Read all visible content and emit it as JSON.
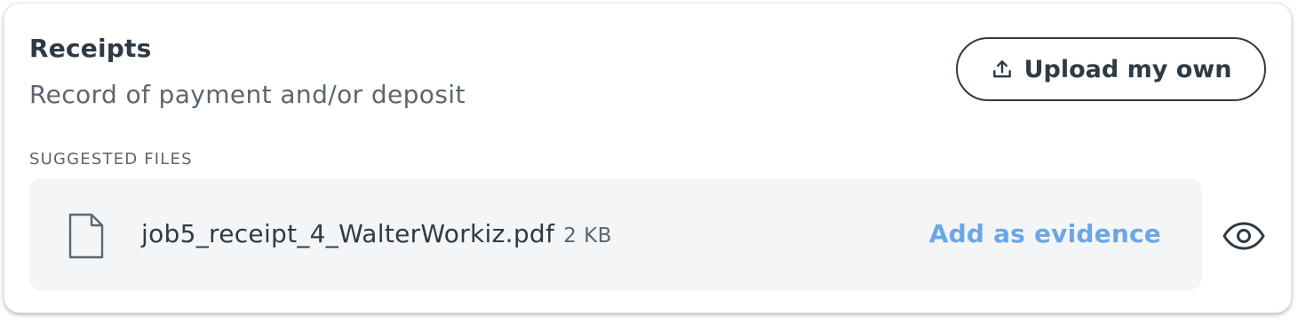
{
  "card": {
    "title": "Receipts",
    "subtitle": "Record of payment and/or deposit",
    "upload_button_label": "Upload my own"
  },
  "suggested": {
    "section_label": "SUGGESTED FILES",
    "files": [
      {
        "name": "job5_receipt_4_WalterWorkiz.pdf",
        "size": "2 KB",
        "action_label": "Add as evidence",
        "icon": "file-icon"
      }
    ]
  },
  "icons": {
    "upload": "upload-icon",
    "preview": "eye-icon"
  },
  "colors": {
    "text_primary": "#2e3a45",
    "text_secondary": "#5b6670",
    "accent": "#6aa7e8",
    "row_background": "#f3f5f7"
  }
}
